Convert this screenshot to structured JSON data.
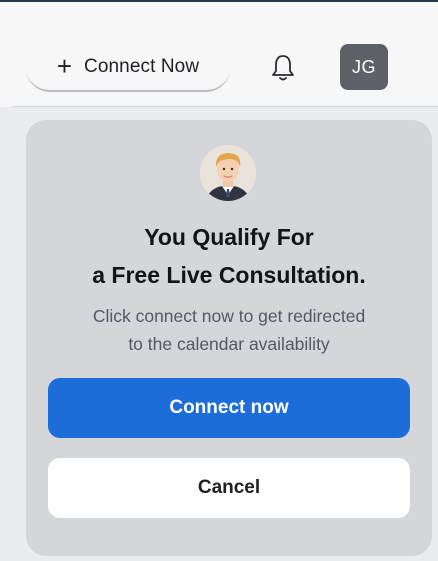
{
  "header": {
    "connect_label": "Connect Now",
    "plus_icon": "+",
    "bell_icon": "bell-icon",
    "user_initials": "JG"
  },
  "modal": {
    "title_line1": "You Qualify For",
    "title_line2": "a Free Live Consultation.",
    "description_line1": "Click connect now to get redirected",
    "description_line2": "to the calendar availability",
    "primary_button": "Connect now",
    "secondary_button": "Cancel"
  },
  "colors": {
    "primary": "#1c6cd9",
    "avatar_bg": "#5e6168",
    "modal_bg": "#d4d6da",
    "top_border": "#2b3a4a"
  }
}
